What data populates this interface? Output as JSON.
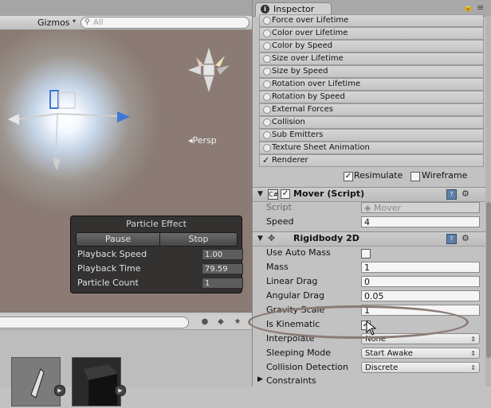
{
  "scene": {
    "toolbar": {
      "gizmos_label": "Gizmos",
      "gizmos_caret": "▾",
      "search_icon": "search-icon",
      "search_placeholder": "All"
    },
    "persp_label": "Persp",
    "persp_prefix": "◂",
    "particle_effect": {
      "title": "Particle Effect",
      "pause_label": "Pause",
      "stop_label": "Stop",
      "rows": [
        {
          "label": "Playback Speed",
          "value": "1.00"
        },
        {
          "label": "Playback Time",
          "value": "79.59"
        },
        {
          "label": "Particle Count",
          "value": "1"
        }
      ]
    }
  },
  "project": {
    "toolbar_icons": [
      "labels-icon",
      "tag-icon",
      "star-icon"
    ],
    "play_glyph": "▶"
  },
  "inspector": {
    "tab_label": "Inspector",
    "info_glyph": "i",
    "lock_glyph": "🔒",
    "menu_glyph": "≡",
    "modules": [
      {
        "label": "Force over Lifetime",
        "enabled": false
      },
      {
        "label": "Color over Lifetime",
        "enabled": false
      },
      {
        "label": "Color by Speed",
        "enabled": false
      },
      {
        "label": "Size over Lifetime",
        "enabled": false
      },
      {
        "label": "Size by Speed",
        "enabled": false
      },
      {
        "label": "Rotation over Lifetime",
        "enabled": false
      },
      {
        "label": "Rotation by Speed",
        "enabled": false
      },
      {
        "label": "External Forces",
        "enabled": false
      },
      {
        "label": "Collision",
        "enabled": false
      },
      {
        "label": "Sub Emitters",
        "enabled": false
      },
      {
        "label": "Texture Sheet Animation",
        "enabled": false
      },
      {
        "label": "Renderer",
        "enabled": true
      }
    ],
    "check_glyph": "✓",
    "resimulate": {
      "label": "Resimulate",
      "checked": true
    },
    "wireframe": {
      "label": "Wireframe",
      "checked": false
    },
    "mover": {
      "title": "Mover (Script)",
      "script_label": "Script",
      "script_value": "Mover",
      "speed_label": "Speed",
      "speed_value": "4"
    },
    "rigidbody": {
      "title": "Rigidbody 2D",
      "props": [
        {
          "label": "Use Auto Mass",
          "type": "checkbox",
          "value": ""
        },
        {
          "label": "Mass",
          "type": "field",
          "value": "1"
        },
        {
          "label": "Linear Drag",
          "type": "field",
          "value": "0"
        },
        {
          "label": "Angular Drag",
          "type": "field",
          "value": "0.05"
        },
        {
          "label": "Gravity Scale",
          "type": "field",
          "value": "1"
        },
        {
          "label": "Is Kinematic",
          "type": "checkbox",
          "value": "✓"
        },
        {
          "label": "Interpolate",
          "type": "dropdown",
          "value": "None"
        },
        {
          "label": "Sleeping Mode",
          "type": "dropdown",
          "value": "Start Awake"
        },
        {
          "label": "Collision Detection",
          "type": "dropdown",
          "value": "Discrete"
        }
      ],
      "constraints_label": "Constraints"
    },
    "fold_open_glyph": "▼",
    "fold_closed_glyph": "▶",
    "dropdown_caret": "⇕",
    "help_glyph": "?",
    "gear_glyph": "⚙",
    "highlight_color": "#8a7b75"
  }
}
